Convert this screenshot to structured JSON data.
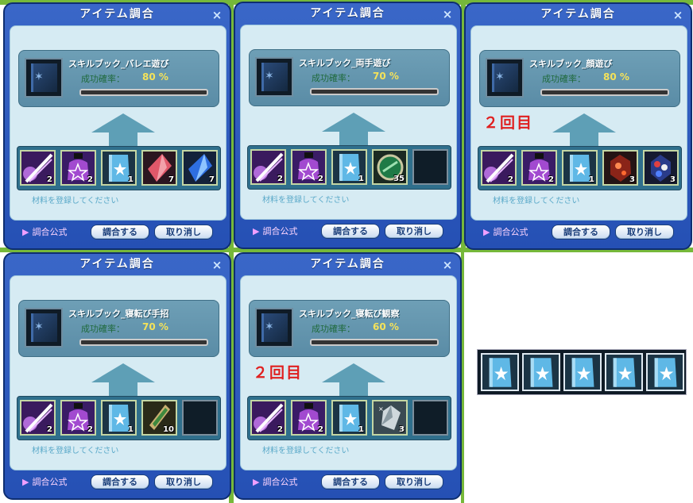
{
  "panels": [
    {
      "title": "アイテム調合",
      "close": "×",
      "recipe_name": "スキルブック_バレエ遊び",
      "rate_label": "成功確率：",
      "rate": "80 %",
      "round": "",
      "slots": [
        {
          "icon": "sword-slash-icon",
          "count": "2"
        },
        {
          "icon": "potion-star-icon",
          "count": "2"
        },
        {
          "icon": "skill-book-icon",
          "count": "1"
        },
        {
          "icon": "red-crystal-icon",
          "count": "7"
        },
        {
          "icon": "blue-crystal-icon",
          "count": "7"
        }
      ],
      "hint": "材料を登録してください",
      "formula": "調合公式",
      "combine": "調合する",
      "cancel": "取り消し"
    },
    {
      "title": "アイテム調合",
      "close": "×",
      "recipe_name": "スキルブック_両手遊び",
      "rate_label": "成功確率：",
      "rate": "70 %",
      "round": "",
      "slots": [
        {
          "icon": "sword-slash-icon",
          "count": "2"
        },
        {
          "icon": "potion-star-icon",
          "count": "2"
        },
        {
          "icon": "skill-book-icon",
          "count": "1"
        },
        {
          "icon": "green-gem-icon",
          "count": "35"
        },
        {
          "icon": "empty",
          "count": ""
        }
      ],
      "hint": "材料を登録してください",
      "formula": "調合公式",
      "combine": "調合する",
      "cancel": "取り消し"
    },
    {
      "title": "アイテム調合",
      "close": "×",
      "recipe_name": "スキルブック_顔遊び",
      "rate_label": "成功確率：",
      "rate": "80 %",
      "round": "２回目",
      "slots": [
        {
          "icon": "sword-slash-icon",
          "count": "2"
        },
        {
          "icon": "potion-star-icon",
          "count": "2"
        },
        {
          "icon": "skill-book-icon",
          "count": "1"
        },
        {
          "icon": "red-ore-icon",
          "count": "3"
        },
        {
          "icon": "multicolor-gem-icon",
          "count": "3"
        }
      ],
      "hint": "材料を登録してください",
      "formula": "調合公式",
      "combine": "調合する",
      "cancel": "取り消し"
    },
    {
      "title": "アイテム調合",
      "close": "×",
      "recipe_name": "スキルブック_寝転び手招",
      "rate_label": "成功確率：",
      "rate": "70 %",
      "round": "",
      "slots": [
        {
          "icon": "sword-slash-icon",
          "count": "2"
        },
        {
          "icon": "potion-star-icon",
          "count": "2"
        },
        {
          "icon": "skill-book-icon",
          "count": "1"
        },
        {
          "icon": "green-scroll-icon",
          "count": "10"
        },
        {
          "icon": "empty",
          "count": ""
        }
      ],
      "hint": "材料を登録してください",
      "formula": "調合公式",
      "combine": "調合する",
      "cancel": "取り消し"
    },
    {
      "title": "アイテム調合",
      "close": "×",
      "recipe_name": "スキルブック_寝転び観察",
      "rate_label": "成功確率：",
      "rate": "60 %",
      "round": "２回目",
      "slots": [
        {
          "icon": "sword-slash-icon",
          "count": "2"
        },
        {
          "icon": "potion-star-icon",
          "count": "2"
        },
        {
          "icon": "skill-book-icon",
          "count": "1"
        },
        {
          "icon": "silver-shard-icon",
          "count": "3"
        },
        {
          "icon": "empty",
          "count": ""
        }
      ],
      "hint": "材料を登録してください",
      "formula": "調合公式",
      "combine": "調合する",
      "cancel": "取り消し"
    }
  ],
  "book_strip": {
    "count": 5,
    "icon": "skill-book-icon"
  },
  "colors": {
    "panel": "#2550b4",
    "inner": "#d6ebf3",
    "round_text": "#e02020",
    "rate_text": "#f4e25a"
  }
}
